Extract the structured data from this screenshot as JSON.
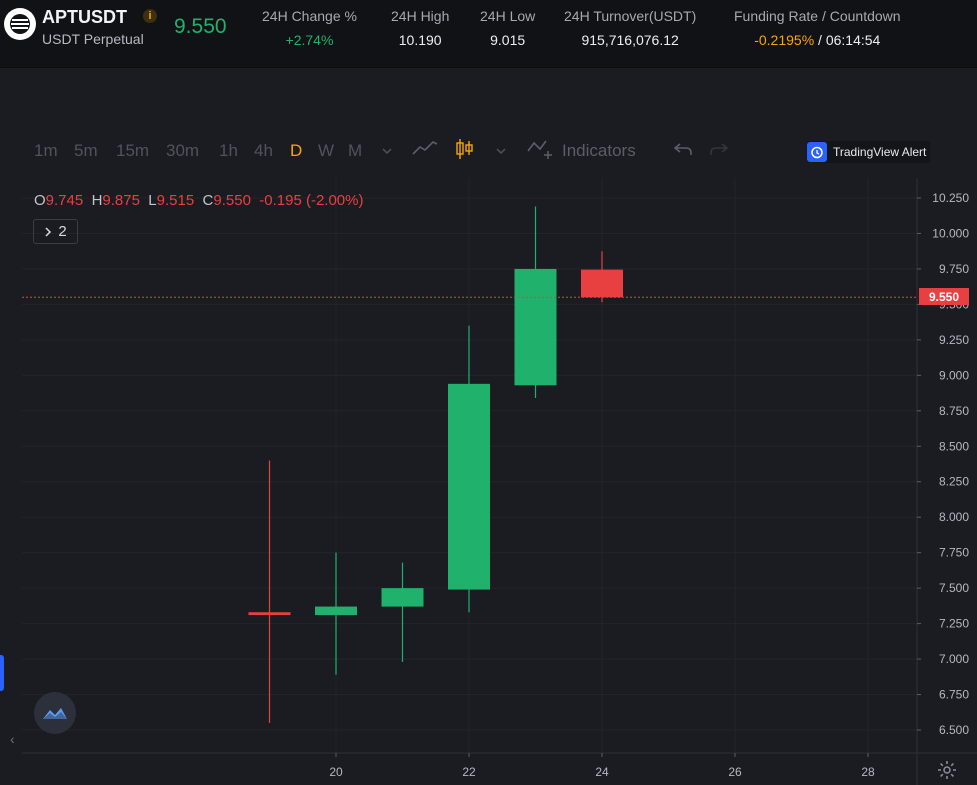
{
  "header": {
    "symbol": "APTUSDT",
    "info_icon": "i",
    "subtitle": "USDT Perpetual",
    "last_price": "9.550",
    "stats": [
      {
        "label": "24H Change %",
        "value": "+2.74%"
      },
      {
        "label": "24H High",
        "value": "10.190"
      },
      {
        "label": "24H Low",
        "value": "9.015"
      },
      {
        "label": "24H Turnover(USDT)",
        "value": "915,716,076.12"
      }
    ],
    "funding": {
      "label": "Funding Rate / Countdown",
      "rate": "-0.2195%",
      "separator": " / ",
      "countdown": "06:14:54"
    }
  },
  "toolbar": {
    "intervals": [
      "1m",
      "5m",
      "15m",
      "30m",
      "1h",
      "4h",
      "D",
      "W",
      "M"
    ],
    "active_interval": "D",
    "indicators_label": "Indicators",
    "alert_label": "TradingView Alert"
  },
  "legend": {
    "o_label": "O",
    "o": "9.745",
    "h_label": "H",
    "h": "9.875",
    "l_label": "L",
    "l": "9.515",
    "c_label": "C",
    "c": "9.550",
    "change": "-0.195 (-2.00%)",
    "collapse_count": "2"
  },
  "colors": {
    "up": "#20b26c",
    "down": "#e84040",
    "accent": "#f7a600",
    "brand": "#2962ff"
  },
  "chart_data": {
    "type": "candlestick",
    "x_ticks": [
      "20",
      "22",
      "24",
      "26",
      "28"
    ],
    "y_ticks": [
      "10.250",
      "10.000",
      "9.750",
      "9.500",
      "9.250",
      "9.000",
      "8.750",
      "8.500",
      "8.250",
      "8.000",
      "7.750",
      "7.500",
      "7.250",
      "7.000",
      "6.750",
      "6.500"
    ],
    "ylim": [
      6.4,
      10.35
    ],
    "xlim": [
      16.8,
      29.8
    ],
    "current_price": "9.550",
    "candles": [
      {
        "day": 19,
        "open": 7.33,
        "high": 8.4,
        "low": 6.55,
        "close": 7.31
      },
      {
        "day": 20,
        "open": 7.31,
        "high": 7.75,
        "low": 6.89,
        "close": 7.37
      },
      {
        "day": 21,
        "open": 7.37,
        "high": 7.68,
        "low": 6.98,
        "close": 7.5
      },
      {
        "day": 22,
        "open": 7.49,
        "high": 9.35,
        "low": 7.33,
        "close": 8.94
      },
      {
        "day": 23,
        "open": 8.93,
        "high": 10.19,
        "low": 8.84,
        "close": 9.75
      },
      {
        "day": 24,
        "open": 9.745,
        "high": 9.875,
        "low": 9.515,
        "close": 9.55
      }
    ]
  }
}
